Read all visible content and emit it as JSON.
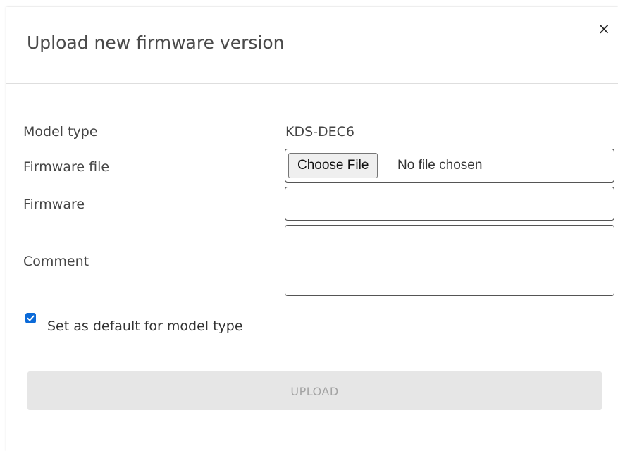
{
  "dialog": {
    "title": "Upload new firmware version",
    "close_label": "×"
  },
  "form": {
    "model_type_label": "Model type",
    "model_type_value": "KDS-DEC6",
    "firmware_file_label": "Firmware file",
    "choose_file_label": "Choose File",
    "no_file_text": "No file chosen",
    "firmware_label": "Firmware",
    "firmware_value": "",
    "comment_label": "Comment",
    "comment_value": "",
    "set_default_label": "Set as default for model type",
    "set_default_checked": true
  },
  "actions": {
    "upload_label": "UPLOAD"
  },
  "colors": {
    "accent": "#0b6ad8",
    "disabled_button_bg": "#e6e6e6",
    "disabled_button_text": "#a3a3a3"
  },
  "icons": {
    "close": "close-icon",
    "check": "check-icon"
  }
}
